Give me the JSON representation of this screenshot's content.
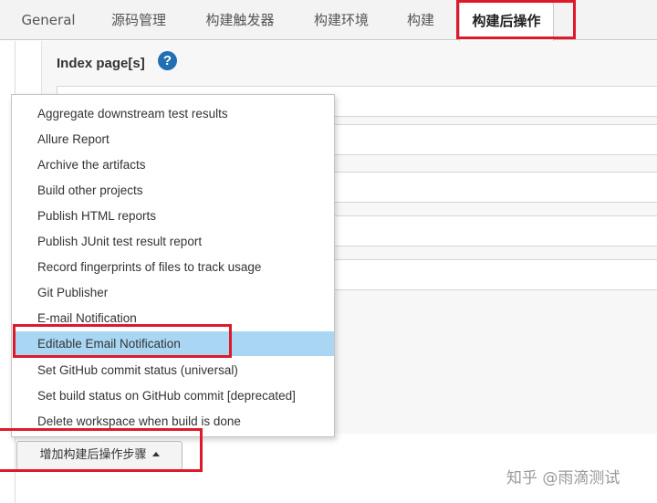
{
  "tabs": [
    {
      "label": "General"
    },
    {
      "label": "源码管理"
    },
    {
      "label": "构建触发器"
    },
    {
      "label": "构建环境"
    },
    {
      "label": "构建"
    },
    {
      "label": "构建后操作",
      "active": true
    }
  ],
  "section": {
    "index_label": "Index page[s]",
    "help_glyph": "?"
  },
  "menu": {
    "items": [
      {
        "label": "Aggregate downstream test results"
      },
      {
        "label": "Allure Report"
      },
      {
        "label": "Archive the artifacts"
      },
      {
        "label": "Build other projects"
      },
      {
        "label": "Publish HTML reports"
      },
      {
        "label": "Publish JUnit test result report"
      },
      {
        "label": "Record fingerprints of files to track usage"
      },
      {
        "label": "Git Publisher"
      },
      {
        "label": "E-mail Notification"
      },
      {
        "label": "Editable Email Notification",
        "selected": true
      },
      {
        "label": "Set GitHub commit status (universal)"
      },
      {
        "label": "Set build status on GitHub commit [deprecated]"
      },
      {
        "label": "Delete workspace when build is done"
      }
    ]
  },
  "add_button": {
    "label": "增加构建后操作步骤"
  },
  "watermark": {
    "text": "知乎 @雨滴测试"
  },
  "colors": {
    "highlight": "#a9d7f3",
    "annotation_red": "#e0192a",
    "help_blue": "#1f6fb2"
  }
}
